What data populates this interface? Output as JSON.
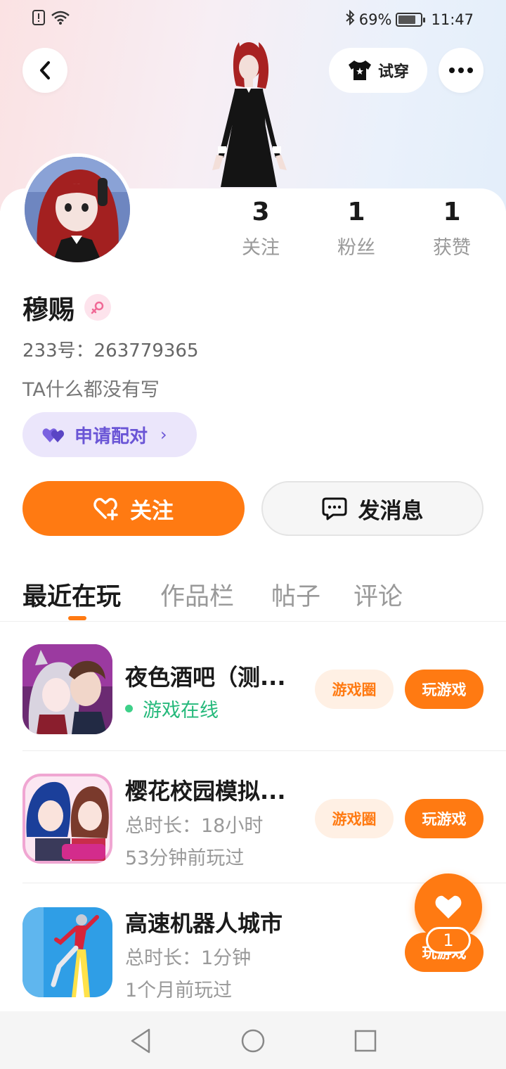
{
  "status": {
    "battery": "69%",
    "time": "11:47"
  },
  "header": {
    "try_on_label": "试穿"
  },
  "profile": {
    "name": "穆赐",
    "uid": "233号：263779365",
    "bio": "TA什么都没有写",
    "stats": [
      {
        "value": "3",
        "label": "关注"
      },
      {
        "value": "1",
        "label": "粉丝"
      },
      {
        "value": "1",
        "label": "获赞"
      }
    ],
    "pair_label": "申请配对",
    "follow_label": "关注",
    "message_label": "发消息"
  },
  "tabs": [
    "最近在玩",
    "作品栏",
    "帖子",
    "评论"
  ],
  "games": [
    {
      "title": "夜色酒吧（测...",
      "line1": "游戏在线",
      "line2": "",
      "circle_label": "游戏圈",
      "play_label": "玩游戏"
    },
    {
      "title": "樱花校园模拟...",
      "line1": "总时长：18小时",
      "line2": "53分钟前玩过",
      "circle_label": "游戏圈",
      "play_label": "玩游戏"
    },
    {
      "title": "高速机器人城市",
      "line1": "总时长：1分钟",
      "line2": "1个月前玩过",
      "circle_label": "",
      "play_label": "玩游戏"
    }
  ],
  "like_count": "1",
  "colors": {
    "accent": "#ff7a12",
    "pair_purple": "#6a55d6",
    "online_green": "#25b97b"
  }
}
